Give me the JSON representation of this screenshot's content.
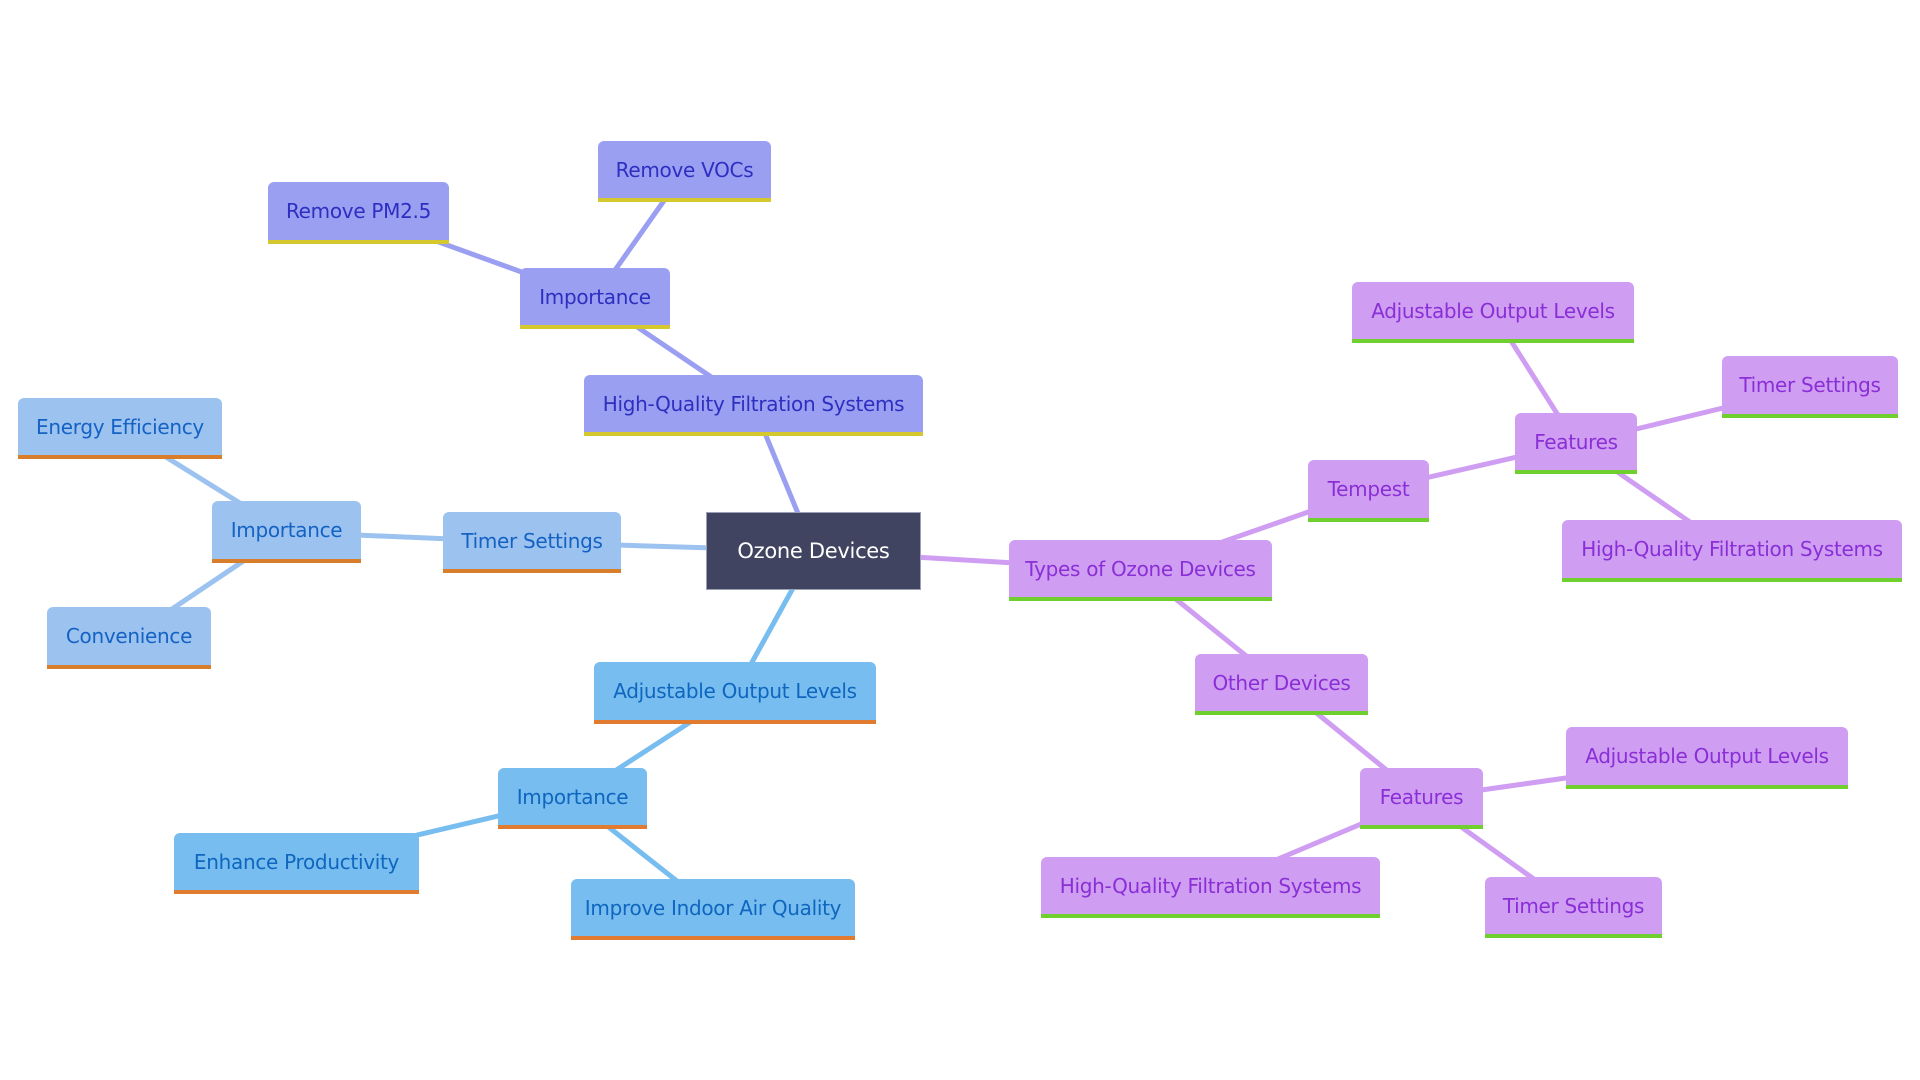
{
  "diagram": {
    "type": "mindmap",
    "root": {
      "id": "root",
      "label": "Ozone Devices"
    },
    "nodes": [
      {
        "id": "root",
        "label": "Ozone Devices",
        "branch": "root"
      },
      {
        "id": "hqfs",
        "label": "High-Quality Filtration Systems",
        "branch": "violet",
        "parent": "root"
      },
      {
        "id": "hqfs-imp",
        "label": "Importance",
        "branch": "violet",
        "parent": "hqfs"
      },
      {
        "id": "pm25",
        "label": "Remove PM2.5",
        "branch": "violet",
        "parent": "hqfs-imp"
      },
      {
        "id": "vocs",
        "label": "Remove VOCs",
        "branch": "violet",
        "parent": "hqfs-imp"
      },
      {
        "id": "timer",
        "label": "Timer Settings",
        "branch": "lightblue",
        "parent": "root"
      },
      {
        "id": "timer-imp",
        "label": "Importance",
        "branch": "lightblue",
        "parent": "timer"
      },
      {
        "id": "energy",
        "label": "Energy Efficiency",
        "branch": "lightblue",
        "parent": "timer-imp"
      },
      {
        "id": "convenience",
        "label": "Convenience",
        "branch": "lightblue",
        "parent": "timer-imp"
      },
      {
        "id": "aol",
        "label": "Adjustable Output Levels",
        "branch": "sky",
        "parent": "root"
      },
      {
        "id": "aol-imp",
        "label": "Importance",
        "branch": "sky",
        "parent": "aol"
      },
      {
        "id": "productivity",
        "label": "Enhance Productivity",
        "branch": "sky",
        "parent": "aol-imp"
      },
      {
        "id": "iaq",
        "label": "Improve Indoor Air Quality",
        "branch": "sky",
        "parent": "aol-imp"
      },
      {
        "id": "types",
        "label": "Types of Ozone Devices",
        "branch": "purple",
        "parent": "root"
      },
      {
        "id": "tempest",
        "label": "Tempest",
        "branch": "purple",
        "parent": "types"
      },
      {
        "id": "tempest-feat",
        "label": "Features",
        "branch": "purple",
        "parent": "tempest"
      },
      {
        "id": "tempest-aol",
        "label": "Adjustable Output Levels",
        "branch": "purple",
        "parent": "tempest-feat"
      },
      {
        "id": "tempest-timer",
        "label": "Timer Settings",
        "branch": "purple",
        "parent": "tempest-feat"
      },
      {
        "id": "tempest-hqfs",
        "label": "High-Quality Filtration Systems",
        "branch": "purple",
        "parent": "tempest-feat"
      },
      {
        "id": "other",
        "label": "Other Devices",
        "branch": "purple",
        "parent": "types"
      },
      {
        "id": "other-feat",
        "label": "Features",
        "branch": "purple",
        "parent": "other"
      },
      {
        "id": "other-aol",
        "label": "Adjustable Output Levels",
        "branch": "purple",
        "parent": "other-feat"
      },
      {
        "id": "other-hqfs",
        "label": "High-Quality Filtration Systems",
        "branch": "purple",
        "parent": "other-feat"
      },
      {
        "id": "other-timer",
        "label": "Timer Settings",
        "branch": "purple",
        "parent": "other-feat"
      }
    ]
  },
  "colors": {
    "root": {
      "fill": "#414460",
      "text": "#ffffff",
      "edge": "#414460"
    },
    "violet": {
      "fill": "#9a9ff2",
      "text": "#2d2fc0",
      "underline": "#d4c82e",
      "edge": "#9a9ff2"
    },
    "lightblue": {
      "fill": "#9cc3ef",
      "text": "#1462c4",
      "underline": "#d87d2a",
      "edge": "#9cc3ef"
    },
    "sky": {
      "fill": "#78bdf0",
      "text": "#0e66be",
      "underline": "#e07b2f",
      "edge": "#78bdf0"
    },
    "purple": {
      "fill": "#cf9ef2",
      "text": "#8a2ed6",
      "underline": "#6fcf2e",
      "edge": "#cf9ef2"
    }
  }
}
